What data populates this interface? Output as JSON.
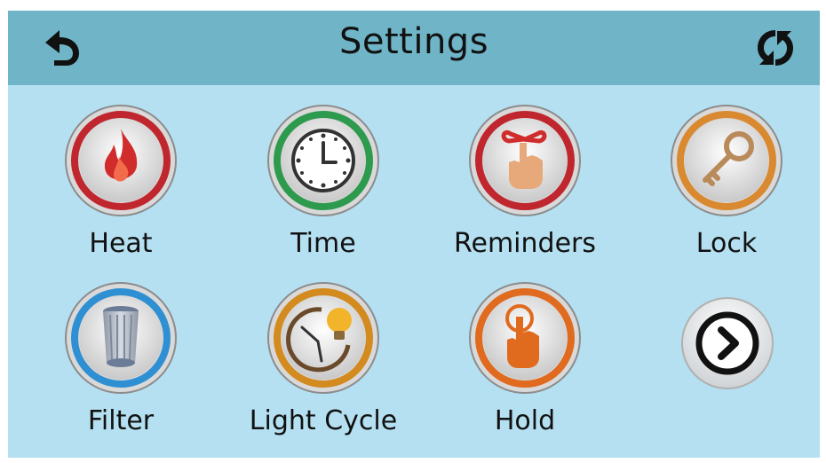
{
  "header": {
    "title": "Settings",
    "back_icon": "back-arrow-icon",
    "refresh_icon": "refresh-icon"
  },
  "tiles": [
    {
      "label": "Heat",
      "icon": "flame-icon",
      "accent": "#c0262d"
    },
    {
      "label": "Time",
      "icon": "clock-icon",
      "accent": "#2e9a4e"
    },
    {
      "label": "Reminders",
      "icon": "reminder-hand-icon",
      "accent": "#c0262d"
    },
    {
      "label": "Lock",
      "icon": "key-icon",
      "accent": "#d9892f"
    },
    {
      "label": "Filter",
      "icon": "filter-cartridge-icon",
      "accent": "#2f8fd3"
    },
    {
      "label": "Light Cycle",
      "icon": "light-cycle-icon",
      "accent": "#d38a1f"
    },
    {
      "label": "Hold",
      "icon": "hold-hand-icon",
      "accent": "#e06a1e"
    }
  ],
  "next_icon": "chevron-right-icon",
  "colors": {
    "background": "#b5e0f1",
    "header": "#6fb4c7"
  }
}
